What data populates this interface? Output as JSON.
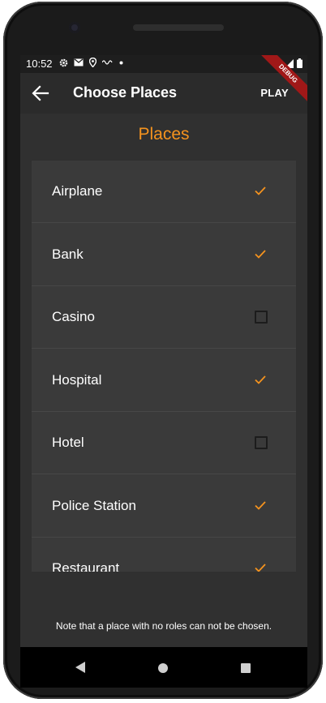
{
  "status": {
    "time": "10:52"
  },
  "appbar": {
    "title": "Choose Places",
    "play_label": "PLAY",
    "debug_label": "DEBUG"
  },
  "section_title": "Places",
  "places": [
    {
      "label": "Airplane",
      "checked": true
    },
    {
      "label": "Bank",
      "checked": true
    },
    {
      "label": "Casino",
      "checked": false
    },
    {
      "label": "Hospital",
      "checked": true
    },
    {
      "label": "Hotel",
      "checked": false
    },
    {
      "label": "Police Station",
      "checked": true
    },
    {
      "label": "Restaurant",
      "checked": true
    }
  ],
  "footer_note": "Note that a place with no roles can not be chosen.",
  "colors": {
    "accent": "#f5931e",
    "background": "#303030",
    "card": "#3a3a3a",
    "appbar": "#2b2b2b"
  }
}
